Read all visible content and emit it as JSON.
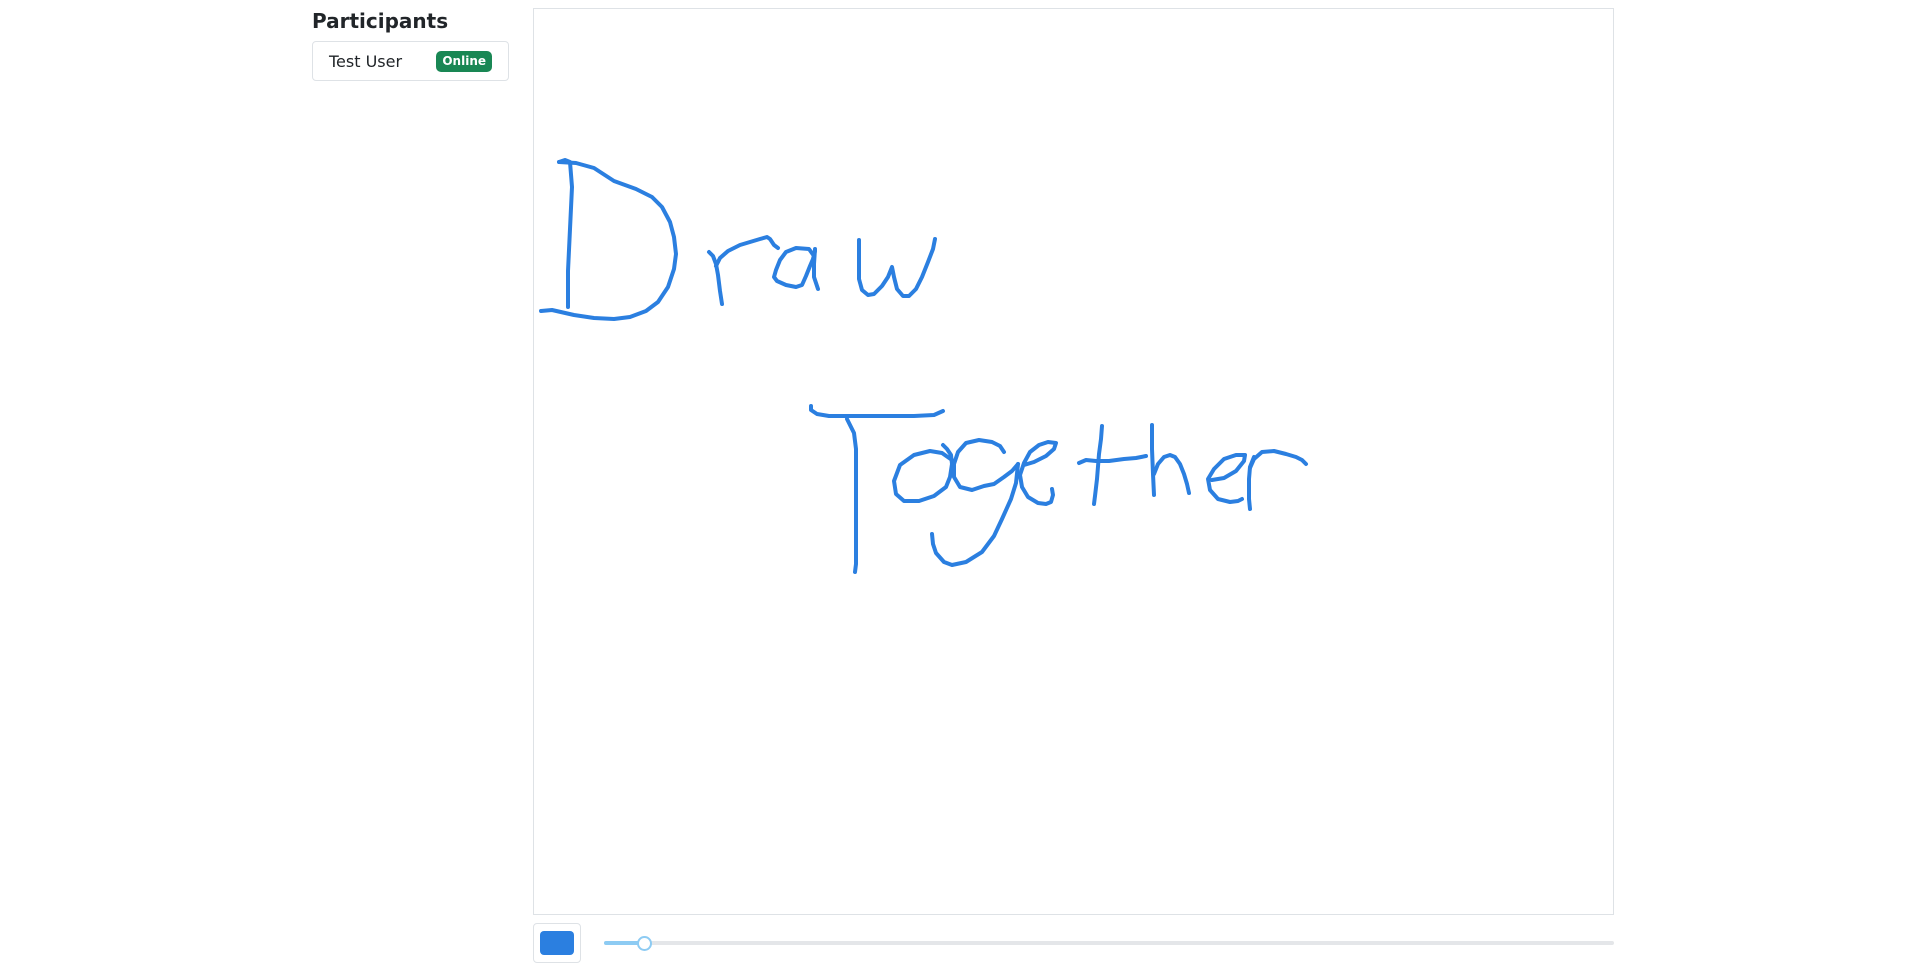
{
  "participants": {
    "title": "Participants",
    "users": [
      {
        "name": "Test User",
        "status": "Online"
      }
    ]
  },
  "toolbar": {
    "stroke_color": "#2b7fe0",
    "brush_size_fraction": 0.04
  },
  "canvas": {
    "background": "#ffffff",
    "stroke_color": "#2b7fe0"
  },
  "colors": {
    "online_badge": "#198754",
    "slider_accent": "#8dcbf3"
  }
}
